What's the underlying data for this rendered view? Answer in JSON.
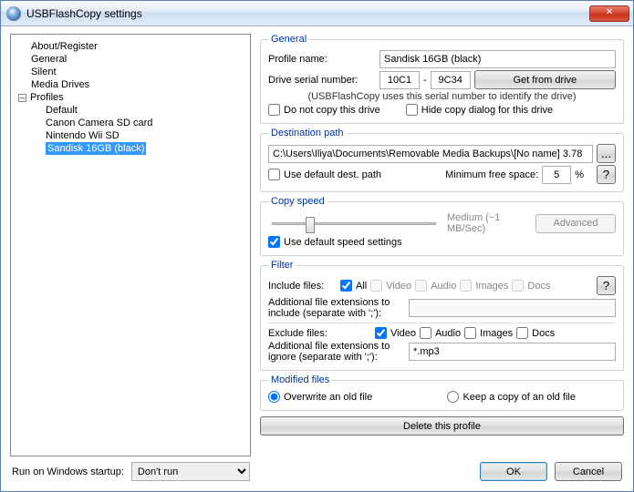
{
  "window": {
    "title": "USBFlashCopy settings"
  },
  "tree": {
    "items": [
      "About/Register",
      "General",
      "Silent",
      "Media Drives"
    ],
    "profiles_label": "Profiles",
    "profiles": [
      "Default",
      "Canon Camera SD card",
      "Nintendo Wii SD",
      "Sandisk 16GB (black)"
    ],
    "selected_index": 3
  },
  "general": {
    "legend": "General",
    "profile_name_label": "Profile name:",
    "profile_name": "Sandisk 16GB (black)",
    "serial_label": "Drive serial number:",
    "serial1": "10C1",
    "serial_sep": "-",
    "serial2": "9C34",
    "get_from_drive": "Get from drive",
    "note": "(USBFlashCopy uses this serial number to identify the drive)",
    "do_not_copy": "Do not copy this drive",
    "hide_dialog": "Hide copy dialog for this drive"
  },
  "dest": {
    "legend": "Destination path",
    "path": "C:\\Users\\Iliya\\Documents\\Removable Media Backups\\[No name] 3.78",
    "browse": "...",
    "use_default": "Use default dest. path",
    "min_free_label": "Minimum free space:",
    "min_free": "5",
    "pct": "%",
    "q": "?"
  },
  "speed": {
    "legend": "Copy speed",
    "desc": "Medium (~1 MB/Sec)",
    "advanced": "Advanced",
    "use_default": "Use default speed settings"
  },
  "filter": {
    "legend": "Filter",
    "include_label": "Include files:",
    "all": "All",
    "video": "Video",
    "audio": "Audio",
    "images": "Images",
    "docs": "Docs",
    "q": "?",
    "add_include_label": "Additional file extensions to include (separate with ';'):",
    "add_include": "",
    "exclude_label": "Exclude files:",
    "add_exclude_label": "Additional file extensions to ignore (separate with ';'):",
    "add_exclude": "*.mp3"
  },
  "modified": {
    "legend": "Modified files",
    "overwrite": "Overwrite an old file",
    "keep": "Keep a copy of an old file"
  },
  "delete_btn": "Delete this profile",
  "footer": {
    "startup_label": "Run on Windows startup:",
    "startup_value": "Don't run",
    "ok": "OK",
    "cancel": "Cancel"
  }
}
